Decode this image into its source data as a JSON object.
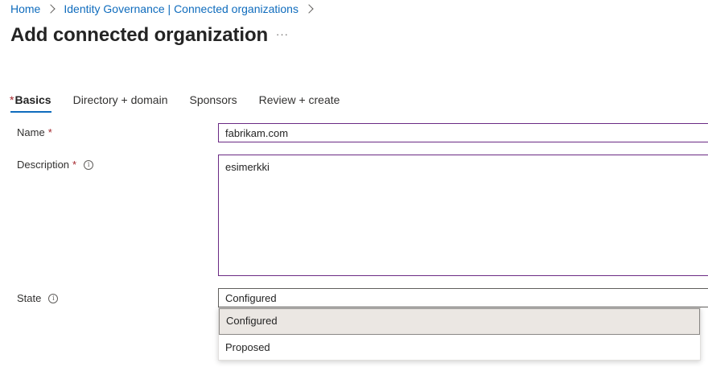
{
  "breadcrumb": {
    "items": [
      "Home",
      "Identity Governance | Connected organizations"
    ]
  },
  "page": {
    "title": "Add connected organization",
    "more": "···"
  },
  "tabs": [
    {
      "label": "Basics",
      "required": "*"
    },
    {
      "label": "Directory + domain"
    },
    {
      "label": "Sponsors"
    },
    {
      "label": "Review + create"
    }
  ],
  "form": {
    "name": {
      "label": "Name",
      "required": "*",
      "value": "fabrikam.com"
    },
    "description": {
      "label": "Description",
      "required": "*",
      "value": "esimerkki"
    },
    "state": {
      "label": "State",
      "value": "Configured",
      "options": [
        "Configured",
        "Proposed"
      ]
    }
  },
  "icons": {
    "info": "info-icon",
    "chevron": "chevron-right-icon"
  },
  "colors": {
    "accent": "#0f6cbd",
    "focus_border": "#6b2a84",
    "required": "#a4262c"
  }
}
